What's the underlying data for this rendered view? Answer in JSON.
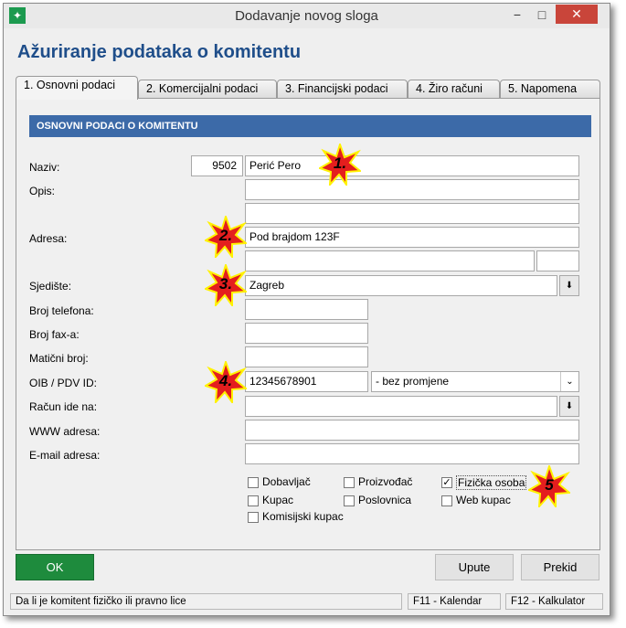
{
  "window": {
    "title": "Dodavanje novog sloga",
    "close_icon": "close-icon",
    "minimize_glyph": "−",
    "maximize_glyph": "□",
    "close_glyph": "✕",
    "app_icon_glyph": "✦"
  },
  "page": {
    "title": "Ažuriranje podataka o komitentu"
  },
  "tabs": [
    {
      "label": "1. Osnovni podaci"
    },
    {
      "label": "2. Komercijalni podaci"
    },
    {
      "label": "3. Financijski podaci"
    },
    {
      "label": "4. Žiro računi"
    },
    {
      "label": "5. Napomena"
    }
  ],
  "section": {
    "header": "OSNOVNI PODACI O KOMITENTU"
  },
  "form": {
    "naziv_label": "Naziv:",
    "naziv_code": "9502",
    "naziv_value": "Perić Pero",
    "opis_label": "Opis:",
    "adresa_label": "Adresa:",
    "adresa_value": "Pod brajdom 123F",
    "sjediste_label": "Sjedište:",
    "sjediste_value": "Zagreb",
    "telefon_label": "Broj telefona:",
    "fax_label": "Broj fax-a:",
    "maticni_label": "Matični broj:",
    "oib_label": "OIB / PDV ID:",
    "oib_value": "12345678901",
    "pdv_option": "- bez promjene",
    "racun_label": "Račun ide na:",
    "www_label": "WWW adresa:",
    "email_label": "E-mail adresa:",
    "dropdown_glyph": "⬇",
    "combo_glyph": "⌄"
  },
  "checkboxes": {
    "check_mark": "✓",
    "dobavljac": {
      "label": "Dobavljač",
      "checked": false
    },
    "proizvodac": {
      "label": "Proizvođač",
      "checked": false
    },
    "fizicka": {
      "label": "Fizička osoba",
      "checked": true
    },
    "kupac": {
      "label": "Kupac",
      "checked": false
    },
    "poslovnica": {
      "label": "Poslovnica",
      "checked": false
    },
    "web_kupac": {
      "label": "Web kupac",
      "checked": false
    },
    "komisijski": {
      "label": "Komisijski kupac",
      "checked": false
    }
  },
  "markers": [
    "1.",
    "2.",
    "3.",
    "4.",
    "5"
  ],
  "buttons": {
    "ok": "OK",
    "upute": "Upute",
    "prekid": "Prekid"
  },
  "status": {
    "hint": "Da li je komitent fizičko ili pravno lice",
    "f11": "F11 - Kalendar",
    "f12": "F12 - Kalkulator"
  },
  "colors": {
    "accent": "#1f4e8a",
    "header_bar": "#3c6aa8",
    "ok_button": "#1e8b3d",
    "close_button": "#c9453a",
    "marker_star": "#e41e1e"
  }
}
